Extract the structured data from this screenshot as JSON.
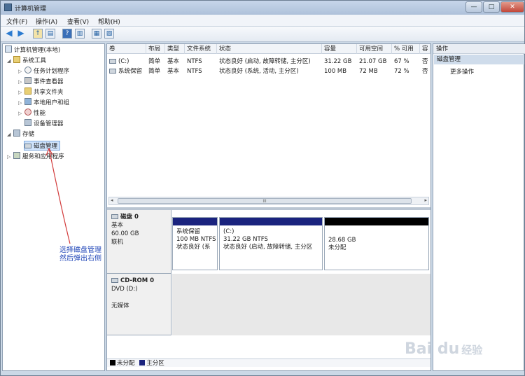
{
  "window": {
    "title": "计算机管理",
    "controls": {
      "minimize": "—",
      "maximize": "□",
      "close": "✕"
    }
  },
  "menu": [
    "文件(F)",
    "操作(A)",
    "查看(V)",
    "帮助(H)"
  ],
  "tree": {
    "root": "计算机管理(本地)",
    "system_tools": "系统工具",
    "task_scheduler": "任务计划程序",
    "event_viewer": "事件查看器",
    "shared_folders": "共享文件夹",
    "local_users": "本地用户和组",
    "performance": "性能",
    "device_manager": "设备管理器",
    "storage": "存储",
    "disk_management": "磁盘管理",
    "services": "服务和应用程序"
  },
  "volumes": {
    "headers": [
      "卷",
      "布局",
      "类型",
      "文件系统",
      "状态",
      "容量",
      "可用空间",
      "% 可用",
      "容"
    ],
    "rows": [
      [
        "(C:)",
        "简单",
        "基本",
        "NTFS",
        "状态良好 (启动, 故障转储, 主分区)",
        "31.22 GB",
        "21.07 GB",
        "67 %",
        "否"
      ],
      [
        "系统保留",
        "简单",
        "基本",
        "NTFS",
        "状态良好 (系统, 活动, 主分区)",
        "100 MB",
        "72 MB",
        "72 %",
        "否"
      ]
    ],
    "scroll_grip": "III"
  },
  "disk0": {
    "name": "磁盘 0",
    "type": "基本",
    "size": "60.00 GB",
    "status": "联机",
    "partitions": [
      {
        "name": "系统保留",
        "size": "100 MB NTFS",
        "status": "状态良好 (系",
        "color": "#1a237e"
      },
      {
        "name": "(C:)",
        "size": "31.22 GB NTFS",
        "status": "状态良好 (启动, 故障转储, 主分区",
        "color": "#1a237e"
      },
      {
        "name": "",
        "size": "28.68 GB",
        "status": "未分配",
        "color": "#000000"
      }
    ]
  },
  "cdrom0": {
    "name": "CD-ROM 0",
    "drive": "DVD (D:)",
    "status": "无媒体"
  },
  "legend": [
    {
      "label": "未分配",
      "color": "#000000"
    },
    {
      "label": "主分区",
      "color": "#1a237e"
    }
  ],
  "actions": {
    "title": "操作",
    "section": "磁盘管理",
    "more": "更多操作"
  },
  "annotation": {
    "line1": "选择磁盘管理",
    "line2": "然后弹出右侧"
  },
  "watermark": {
    "brand": "Bai du",
    "sub": "经验"
  }
}
